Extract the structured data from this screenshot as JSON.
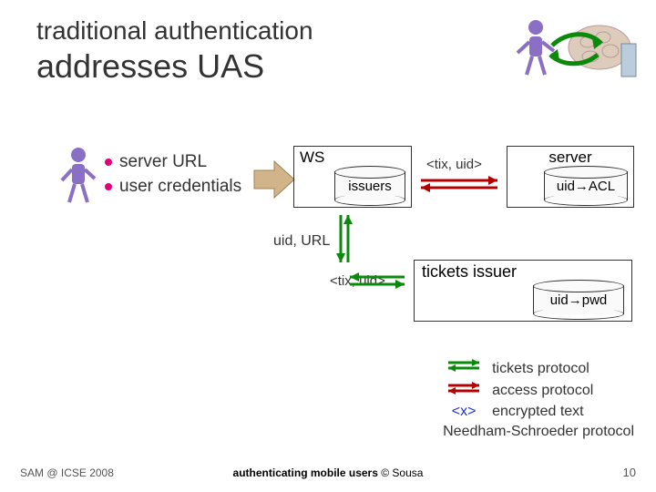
{
  "title": {
    "line1": "traditional authentication",
    "line2": "addresses UAS"
  },
  "bullets": {
    "b1": "server URL",
    "b2": "user credentials"
  },
  "ws": {
    "label": "WS",
    "issuers": "issuers"
  },
  "server": {
    "label": "server",
    "acl": "uid→ACL"
  },
  "labels": {
    "tix1": "<tix, uid>",
    "uid_url": "uid, URL",
    "tix2": "<tix, uid>",
    "enc": "<x>"
  },
  "ti": {
    "label": "tickets issuer",
    "pwd": "uid→pwd"
  },
  "legend": {
    "l1": "tickets protocol",
    "l2": "access protocol",
    "l3": "encrypted text",
    "l4": "Needham-Schroeder protocol"
  },
  "footer": {
    "left": "SAM @ ICSE 2008",
    "center_bold": "authenticating mobile users",
    "center_copy": " © Sousa",
    "right": "10"
  },
  "colors": {
    "red": "#b30000",
    "green": "#0a8a0a",
    "blue": "#2233cc"
  }
}
